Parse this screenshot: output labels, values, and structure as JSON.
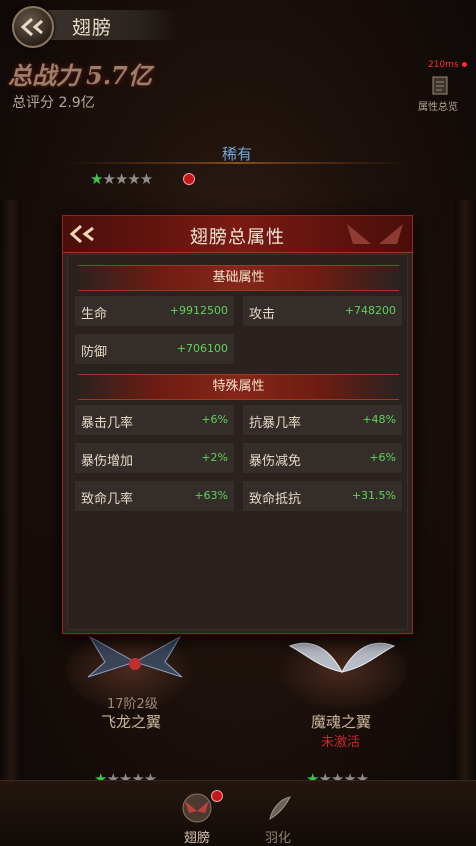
{
  "header": {
    "title": "翅膀"
  },
  "power": {
    "label": "总战力",
    "value": "5.7亿"
  },
  "score": "总评分 2.9亿",
  "ping": "210ms",
  "summary_button": "属性总览",
  "rarity": "稀有",
  "wings": [
    {
      "level": "17阶2级",
      "name": "飞龙之翼",
      "status": ""
    },
    {
      "level": "",
      "name": "魔魂之翼",
      "status": "未激活"
    }
  ],
  "modal": {
    "title": "翅膀总属性",
    "basic_header": "基础属性",
    "basic": [
      {
        "name": "生命",
        "value": "+9912500"
      },
      {
        "name": "攻击",
        "value": "+748200"
      },
      {
        "name": "防御",
        "value": "+706100"
      }
    ],
    "special_header": "特殊属性",
    "special": [
      {
        "name": "暴击几率",
        "value": "+6%"
      },
      {
        "name": "抗暴几率",
        "value": "+48%"
      },
      {
        "name": "暴伤增加",
        "value": "+2%"
      },
      {
        "name": "暴伤减免",
        "value": "+6%"
      },
      {
        "name": "致命几率",
        "value": "+63%"
      },
      {
        "name": "致命抵抗",
        "value": "+31.5%"
      }
    ]
  },
  "nav": [
    {
      "label": "翅膀"
    },
    {
      "label": "羽化"
    }
  ],
  "colors": {
    "accent": "#86261a",
    "stat_value": "#5ed35a",
    "rarity": "#6fa8d8",
    "inactive": "#c42a2a"
  }
}
